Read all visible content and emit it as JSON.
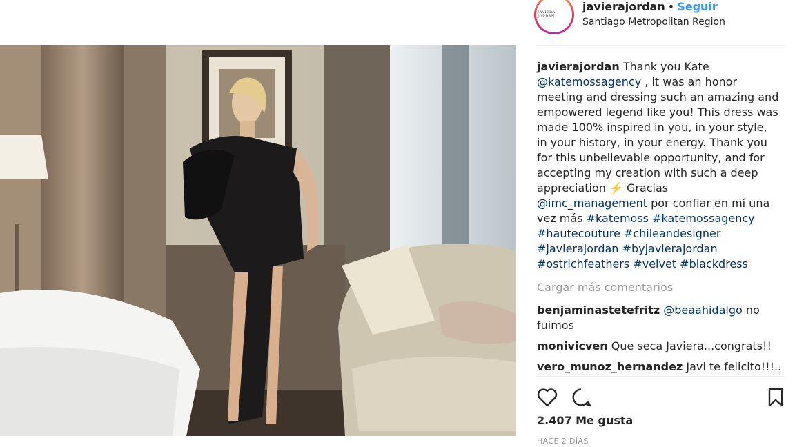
{
  "header": {
    "username": "javierajordan",
    "separator": "•",
    "follow_label": "Seguir",
    "location": "Santiago Metropolitan Region",
    "avatar_text": "JAVIERA JORDAN"
  },
  "caption": {
    "username": "javierajordan",
    "parts": {
      "t1": "Thank you Kate",
      "m1": "@katemossagency",
      "t2": ", it was an honor meeting and dressing such an amazing and empowered legend like you! This dress was made 100% inspired in you, in your style, in your history, in your energy. Thank you for this unbelievable opportunity, and for accepting my creation with such a deep appreciation ⚡️ Gracias",
      "m2": "@imc_management",
      "t3": "por confiar en mí una vez más",
      "h1": "#katemoss",
      "h2": "#katemossagency",
      "h3": "#hautecouture",
      "h4": "#chileandesigner",
      "h5": "#javierajordan",
      "h6": "#byjavierajordan",
      "h7": "#ostrichfeathers",
      "h8": "#velvet",
      "h9": "#blackdress"
    }
  },
  "load_more_label": "Cargar más comentarios",
  "comments": [
    {
      "username": "benjaminastetefritz",
      "mention": "@beaahidalgo",
      "text": "no fuimos"
    },
    {
      "username": "monivicven",
      "text": "Que seca Javiera...congrats!!"
    },
    {
      "username": "vero_munoz_hernandez",
      "text": "Javi te felicito!!!... el"
    }
  ],
  "likes_text": "2.407 Me gusta",
  "timestamp": "HACE 2 DÍAS",
  "icons": {
    "like": "heart-icon",
    "comment": "comment-icon",
    "save": "bookmark-icon"
  },
  "colors": {
    "link": "#003569",
    "follow": "#3897f0",
    "muted": "#999999",
    "text": "#262626"
  }
}
